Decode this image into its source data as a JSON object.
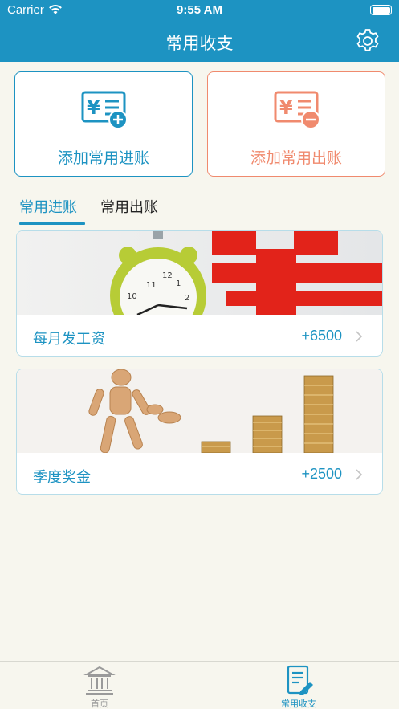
{
  "status_bar": {
    "carrier": "Carrier",
    "time": "9:55 AM",
    "icons": [
      "wifi-icon",
      "battery-icon"
    ]
  },
  "nav": {
    "title": "常用收支",
    "icon": "gear-icon"
  },
  "actions": {
    "income_label": "添加常用进账",
    "expense_label": "添加常用出账"
  },
  "tabs": [
    {
      "label": "常用进账",
      "selected": true
    },
    {
      "label": "常用出账",
      "selected": false
    }
  ],
  "entries": [
    {
      "name": "每月发工资",
      "amount": "+6500",
      "image": "alarm-clock-and-yuan-sign-photo"
    },
    {
      "name": "季度奖金",
      "amount": "+2500",
      "image": "wooden-figure-and-coin-stacks-photo"
    }
  ],
  "tab_bar": [
    {
      "label": "首页",
      "icon": "bank-icon",
      "selected": false
    },
    {
      "label": "常用收支",
      "icon": "notebook-pen-icon",
      "selected": true
    }
  ],
  "colors": {
    "primary": "#1d93c2",
    "expense": "#f08a6e",
    "background": "#f7f6ee"
  }
}
